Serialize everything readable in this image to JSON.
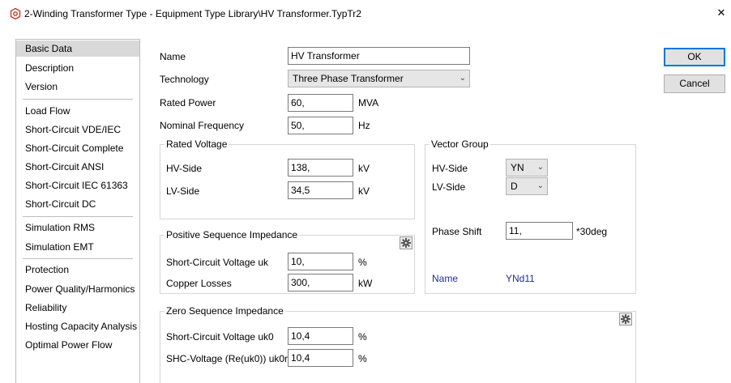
{
  "window": {
    "title": "2-Winding Transformer Type - Equipment Type Library\\HV Transformer.TypTr2",
    "close_label": "✕"
  },
  "nav": {
    "items": [
      {
        "label": "Basic Data"
      },
      {
        "label": "Description"
      },
      {
        "label": "Version"
      },
      {
        "label": "Load Flow"
      },
      {
        "label": "Short-Circuit VDE/IEC"
      },
      {
        "label": "Short-Circuit Complete"
      },
      {
        "label": "Short-Circuit ANSI"
      },
      {
        "label": "Short-Circuit IEC 61363"
      },
      {
        "label": "Short-Circuit DC"
      },
      {
        "label": "Simulation RMS"
      },
      {
        "label": "Simulation EMT"
      },
      {
        "label": "Protection"
      },
      {
        "label": "Power Quality/Harmonics"
      },
      {
        "label": "Reliability"
      },
      {
        "label": "Hosting Capacity Analysis"
      },
      {
        "label": "Optimal Power Flow"
      }
    ]
  },
  "basic": {
    "name_label": "Name",
    "name_value": "HV Transformer",
    "technology_label": "Technology",
    "technology_value": "Three Phase Transformer",
    "rated_power_label": "Rated Power",
    "rated_power_value": "60,",
    "rated_power_unit": "MVA",
    "nominal_frequency_label": "Nominal Frequency",
    "nominal_frequency_value": "50,",
    "nominal_frequency_unit": "Hz"
  },
  "rated_voltage": {
    "title": "Rated Voltage",
    "hv_label": "HV-Side",
    "hv_value": "138,",
    "hv_unit": "kV",
    "lv_label": "LV-Side",
    "lv_value": "34,5",
    "lv_unit": "kV"
  },
  "vector_group": {
    "title": "Vector Group",
    "hv_label": "HV-Side",
    "hv_value": "YN",
    "lv_label": "LV-Side",
    "lv_value": "D",
    "phase_shift_label": "Phase Shift",
    "phase_shift_value": "11,",
    "phase_shift_unit": "*30deg",
    "name_label": "Name",
    "name_value": "YNd11"
  },
  "positive_seq": {
    "title": "Positive Sequence Impedance",
    "uk_label": "Short-Circuit Voltage uk",
    "uk_value": "10,",
    "uk_unit": "%",
    "cu_label": "Copper Losses",
    "cu_value": "300,",
    "cu_unit": "kW"
  },
  "zero_seq": {
    "title": "Zero Sequence Impedance",
    "uk0_label": "Short-Circuit Voltage uk0",
    "uk0_value": "10,4",
    "uk0_unit": "%",
    "uk0r_label": "SHC-Voltage (Re(uk0)) uk0r",
    "uk0r_value": "10,4",
    "uk0r_unit": "%"
  },
  "buttons": {
    "ok": "OK",
    "cancel": "Cancel"
  },
  "icons": {
    "app": "powerfactory-icon",
    "gear": "gear-icon",
    "chevron": "chevron-down-icon"
  },
  "colors": {
    "selected_nav": "#d9d9d9",
    "vector_name": "#1f2f8a",
    "ok_border": "#0078d7"
  }
}
